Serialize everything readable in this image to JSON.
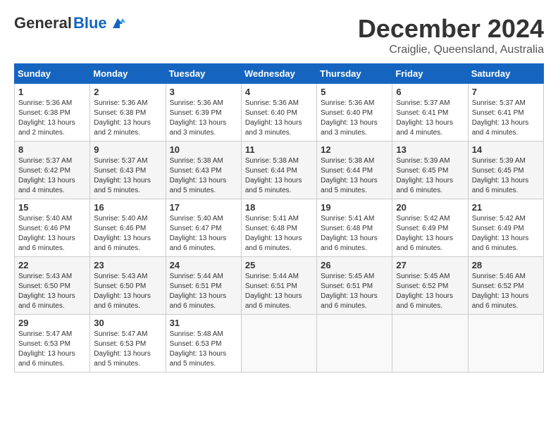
{
  "header": {
    "logo_general": "General",
    "logo_blue": "Blue",
    "month_title": "December 2024",
    "subtitle": "Craiglie, Queensland, Australia"
  },
  "calendar": {
    "days_of_week": [
      "Sunday",
      "Monday",
      "Tuesday",
      "Wednesday",
      "Thursday",
      "Friday",
      "Saturday"
    ],
    "weeks": [
      [
        {
          "day": "",
          "detail": ""
        },
        {
          "day": "2",
          "detail": "Sunrise: 5:36 AM\nSunset: 6:38 PM\nDaylight: 13 hours\nand 2 minutes."
        },
        {
          "day": "3",
          "detail": "Sunrise: 5:36 AM\nSunset: 6:39 PM\nDaylight: 13 hours\nand 3 minutes."
        },
        {
          "day": "4",
          "detail": "Sunrise: 5:36 AM\nSunset: 6:40 PM\nDaylight: 13 hours\nand 3 minutes."
        },
        {
          "day": "5",
          "detail": "Sunrise: 5:36 AM\nSunset: 6:40 PM\nDaylight: 13 hours\nand 3 minutes."
        },
        {
          "day": "6",
          "detail": "Sunrise: 5:37 AM\nSunset: 6:41 PM\nDaylight: 13 hours\nand 4 minutes."
        },
        {
          "day": "7",
          "detail": "Sunrise: 5:37 AM\nSunset: 6:41 PM\nDaylight: 13 hours\nand 4 minutes."
        }
      ],
      [
        {
          "day": "8",
          "detail": "Sunrise: 5:37 AM\nSunset: 6:42 PM\nDaylight: 13 hours\nand 4 minutes."
        },
        {
          "day": "9",
          "detail": "Sunrise: 5:37 AM\nSunset: 6:43 PM\nDaylight: 13 hours\nand 5 minutes."
        },
        {
          "day": "10",
          "detail": "Sunrise: 5:38 AM\nSunset: 6:43 PM\nDaylight: 13 hours\nand 5 minutes."
        },
        {
          "day": "11",
          "detail": "Sunrise: 5:38 AM\nSunset: 6:44 PM\nDaylight: 13 hours\nand 5 minutes."
        },
        {
          "day": "12",
          "detail": "Sunrise: 5:38 AM\nSunset: 6:44 PM\nDaylight: 13 hours\nand 5 minutes."
        },
        {
          "day": "13",
          "detail": "Sunrise: 5:39 AM\nSunset: 6:45 PM\nDaylight: 13 hours\nand 6 minutes."
        },
        {
          "day": "14",
          "detail": "Sunrise: 5:39 AM\nSunset: 6:45 PM\nDaylight: 13 hours\nand 6 minutes."
        }
      ],
      [
        {
          "day": "15",
          "detail": "Sunrise: 5:40 AM\nSunset: 6:46 PM\nDaylight: 13 hours\nand 6 minutes."
        },
        {
          "day": "16",
          "detail": "Sunrise: 5:40 AM\nSunset: 6:46 PM\nDaylight: 13 hours\nand 6 minutes."
        },
        {
          "day": "17",
          "detail": "Sunrise: 5:40 AM\nSunset: 6:47 PM\nDaylight: 13 hours\nand 6 minutes."
        },
        {
          "day": "18",
          "detail": "Sunrise: 5:41 AM\nSunset: 6:48 PM\nDaylight: 13 hours\nand 6 minutes."
        },
        {
          "day": "19",
          "detail": "Sunrise: 5:41 AM\nSunset: 6:48 PM\nDaylight: 13 hours\nand 6 minutes."
        },
        {
          "day": "20",
          "detail": "Sunrise: 5:42 AM\nSunset: 6:49 PM\nDaylight: 13 hours\nand 6 minutes."
        },
        {
          "day": "21",
          "detail": "Sunrise: 5:42 AM\nSunset: 6:49 PM\nDaylight: 13 hours\nand 6 minutes."
        }
      ],
      [
        {
          "day": "22",
          "detail": "Sunrise: 5:43 AM\nSunset: 6:50 PM\nDaylight: 13 hours\nand 6 minutes."
        },
        {
          "day": "23",
          "detail": "Sunrise: 5:43 AM\nSunset: 6:50 PM\nDaylight: 13 hours\nand 6 minutes."
        },
        {
          "day": "24",
          "detail": "Sunrise: 5:44 AM\nSunset: 6:51 PM\nDaylight: 13 hours\nand 6 minutes."
        },
        {
          "day": "25",
          "detail": "Sunrise: 5:44 AM\nSunset: 6:51 PM\nDaylight: 13 hours\nand 6 minutes."
        },
        {
          "day": "26",
          "detail": "Sunrise: 5:45 AM\nSunset: 6:51 PM\nDaylight: 13 hours\nand 6 minutes."
        },
        {
          "day": "27",
          "detail": "Sunrise: 5:45 AM\nSunset: 6:52 PM\nDaylight: 13 hours\nand 6 minutes."
        },
        {
          "day": "28",
          "detail": "Sunrise: 5:46 AM\nSunset: 6:52 PM\nDaylight: 13 hours\nand 6 minutes."
        }
      ],
      [
        {
          "day": "29",
          "detail": "Sunrise: 5:47 AM\nSunset: 6:53 PM\nDaylight: 13 hours\nand 6 minutes."
        },
        {
          "day": "30",
          "detail": "Sunrise: 5:47 AM\nSunset: 6:53 PM\nDaylight: 13 hours\nand 5 minutes."
        },
        {
          "day": "31",
          "detail": "Sunrise: 5:48 AM\nSunset: 6:53 PM\nDaylight: 13 hours\nand 5 minutes."
        },
        {
          "day": "",
          "detail": ""
        },
        {
          "day": "",
          "detail": ""
        },
        {
          "day": "",
          "detail": ""
        },
        {
          "day": "",
          "detail": ""
        }
      ]
    ],
    "week0_sunday": {
      "day": "1",
      "detail": "Sunrise: 5:36 AM\nSunset: 6:38 PM\nDaylight: 13 hours\nand 2 minutes."
    }
  }
}
